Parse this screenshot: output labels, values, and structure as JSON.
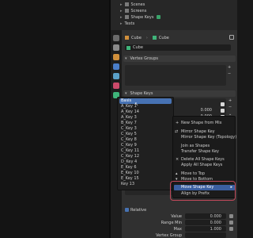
{
  "outliner": {
    "items": [
      {
        "label": "Scenes",
        "color": "#d8d8d8"
      },
      {
        "label": "Screens",
        "color": "#d8d8d8"
      },
      {
        "label": "Shape Keys",
        "color": "#d8d8d8"
      },
      {
        "label": "Texts",
        "color": "#d8d8d8"
      }
    ]
  },
  "breadcrumb": {
    "object": "Cube",
    "data": "Cube"
  },
  "mesh_name": "Cube",
  "panels": {
    "vertex_groups": "Vertex Groups",
    "shape_keys": "Shape Keys"
  },
  "shape_list": {
    "rows": [
      {
        "value": "0.000"
      },
      {
        "value": "0.000"
      }
    ]
  },
  "dropdown": {
    "items": [
      "Basis",
      "A_Key 1",
      "A_Key 14",
      "A_Key 3",
      "B_Key 7",
      "C_Key 3",
      "C_Key 5",
      "C_Key 8",
      "C_Key 9",
      "C_Key 11",
      "C_Key 12",
      "D_Key 4",
      "E_Key 6",
      "E_Key 10",
      "E_Key 15",
      "Key 13"
    ],
    "selected": 0
  },
  "context_menu": {
    "items": [
      {
        "label": "New Shape from Mix",
        "icon": "plus"
      },
      {
        "label": "Mirror Shape Key",
        "icon": "mirror"
      },
      {
        "label": "Mirror Shape Key (Topology)",
        "icon": ""
      },
      {
        "label": "Join as Shapes",
        "icon": ""
      },
      {
        "label": "Transfer Shape Key",
        "icon": ""
      },
      {
        "label": "Delete All Shape Keys",
        "icon": "x"
      },
      {
        "label": "Apply All Shape Keys",
        "icon": ""
      },
      {
        "label": "Move to Top",
        "icon": "up"
      },
      {
        "label": "Move to Bottom",
        "icon": "down"
      },
      {
        "label": "Move Shape Key",
        "icon": ""
      },
      {
        "label": "Align by Prefix",
        "icon": ""
      }
    ],
    "highlighted": 9
  },
  "relative_label": "Relative",
  "fields": {
    "value_label": "Value",
    "value": "0.000",
    "range_min_label": "Range Min",
    "range_min": "0.000",
    "max_label": "Max",
    "max": "1.000",
    "vertex_group_label": "Vertex Group"
  },
  "colors": {
    "accent": "#4772b3",
    "highlight_box": "#c0495a"
  }
}
